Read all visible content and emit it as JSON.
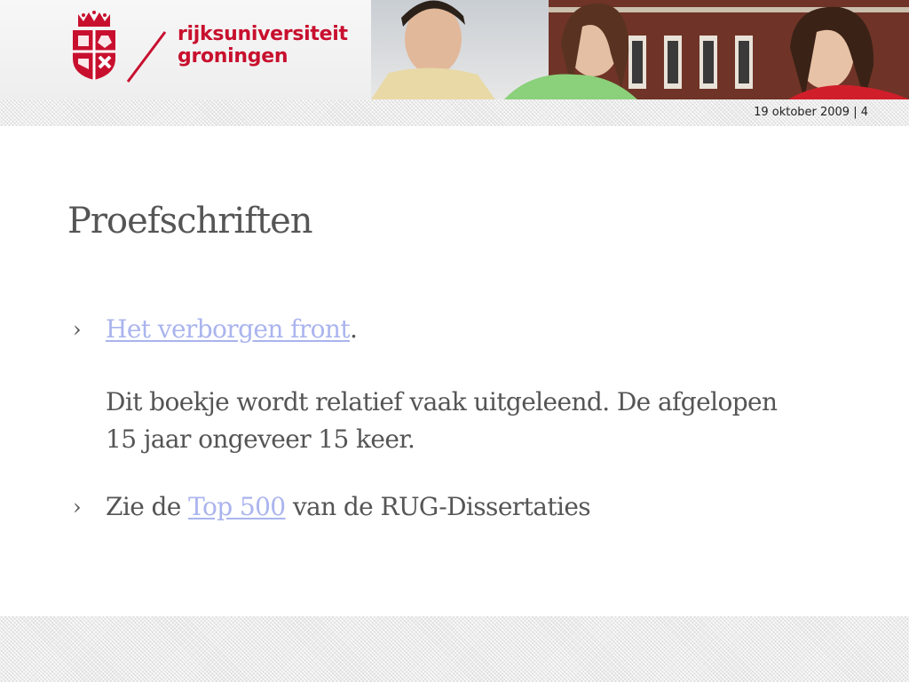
{
  "header": {
    "logo_line1": "rijksuniversiteit",
    "logo_line2": "groningen"
  },
  "slide": {
    "meta": "19 oktober 2009 | 4",
    "title": "Proefschriften",
    "bullet_glyph": "›",
    "bullets": [
      {
        "link_text": "Het verborgen front",
        "after_link": ".",
        "paragraph": "Dit boekje wordt relatief vaak uitgeleend. De afgelopen 15 jaar ongeveer 15 keer."
      },
      {
        "before_link": "Zie de ",
        "link_text": "Top 500",
        "after_link": " van de RUG-Dissertaties"
      }
    ]
  },
  "colors": {
    "brand_red": "#c8102e",
    "text_gray": "#555555",
    "link_blue": "#aab4ee"
  }
}
